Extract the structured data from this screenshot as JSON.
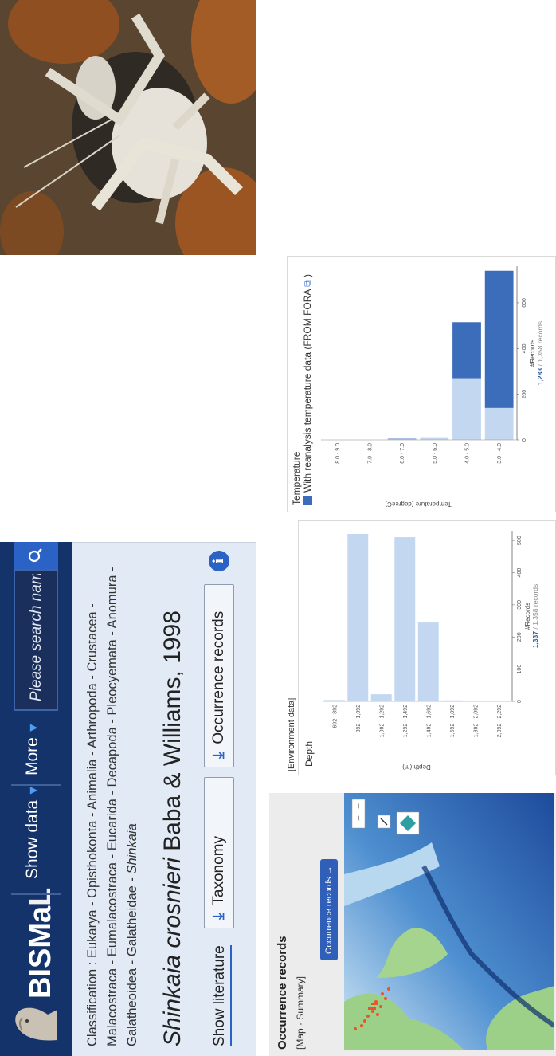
{
  "header": {
    "logo_text_bis": "BISMa",
    "logo_text_l": "L",
    "nav": [
      {
        "label": "Show data",
        "caret": "▼"
      },
      {
        "label": "More",
        "caret": "▼"
      }
    ],
    "search_placeholder": "Please search name."
  },
  "main": {
    "classification_label": "Classification :",
    "classification": "Eukarya - Opisthokonta - Animalia - Arthropoda - Crustacea - Malacostraca - Eumalacostraca - Eucarida - Decapoda - Pleocyemata - Anomura - Galatheoidea - Galatheidae -",
    "genus": "Shinkaia",
    "species_italic": "Shinkaia crosnieri",
    "species_author": "Baba & Williams, 1998",
    "show_literature": "Show literature",
    "taxonomy_button": "Taxonomy",
    "occurrence_button": "Occurrence records"
  },
  "occurrence": {
    "title": "Occurrence records",
    "subtitle": "[Map · Summary]",
    "link": "Occurrence records →"
  },
  "environment": {
    "label": "[Environment data]"
  },
  "colors": {
    "header_bg": "#15336b",
    "accent": "#2a62c6",
    "bar_light": "#c3d7f0",
    "bar_dark": "#3c6dbb",
    "occurrence_points": "#e3572b"
  },
  "chart_data": [
    {
      "type": "bar",
      "title": "Depth",
      "orientation": "horizontal",
      "xlabel": "#Records",
      "ylabel": "Depth (m)",
      "categories": [
        "692 - 892",
        "892 - 1,092",
        "1,092 - 1,292",
        "1,292 - 1,492",
        "1,492 - 1,692",
        "1,692 - 1,892",
        "1,892 - 2,092",
        "2,092 - 2,292"
      ],
      "values": [
        4,
        520,
        22,
        510,
        245,
        3,
        1,
        0
      ],
      "xticks": [
        0,
        100,
        200,
        300,
        400,
        500
      ],
      "xlim": [
        0,
        530
      ],
      "count_bold": "1,337",
      "count_rest": "/ 1,358 records"
    },
    {
      "type": "bar",
      "title": "Temperature",
      "orientation": "horizontal",
      "stacked": true,
      "xlabel": "#Records",
      "ylabel": "Temperature (degreeC)",
      "legend": "With reanalysis temperature data (FROM FORA",
      "legend_link": "FORA",
      "categories": [
        "8.0 - 9.0",
        "7.0 - 8.0",
        "6.0 - 7.0",
        "5.0 - 6.0",
        "4.0 - 5.0",
        "3.0 - 4.0"
      ],
      "series": [
        {
          "values": [
            0,
            0,
            3,
            12,
            270,
            140
          ]
        },
        {
          "name": "With reanalysis temperature data (FROM FORA",
          "values": [
            0,
            0,
            2,
            0,
            245,
            600
          ]
        }
      ],
      "xticks": [
        0,
        200,
        400,
        600
      ],
      "xlim": [
        0,
        760
      ],
      "count_bold": "1,283",
      "count_rest": "/ 1,358 records"
    }
  ]
}
